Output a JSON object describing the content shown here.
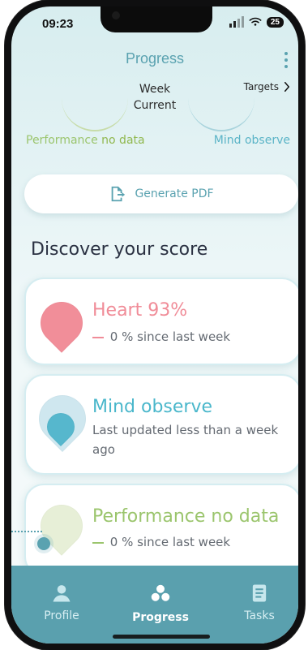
{
  "status": {
    "time": "09:23",
    "battery": "25"
  },
  "header": {
    "title": "Progress",
    "week_label": "Week",
    "current_label": "Current",
    "targets_label": "Targets"
  },
  "legend": {
    "performance_prefix": "Performance",
    "performance_state": "no data",
    "mind_prefix": "Mind",
    "mind_state": "observe"
  },
  "actions": {
    "generate_pdf": "Generate PDF"
  },
  "section": {
    "discover_title": "Discover your score"
  },
  "cards": {
    "heart": {
      "title": "Heart 93%",
      "change": "0 % since last week"
    },
    "mind": {
      "title": "Mind observe",
      "line1": "Last updated less than a week",
      "line2": "ago"
    },
    "performance": {
      "title": "Performance no data",
      "change": "0 % since last week"
    }
  },
  "tabs": [
    {
      "label": "Profile"
    },
    {
      "label": "Progress"
    },
    {
      "label": "Tasks"
    }
  ],
  "colors": {
    "accent": "#5aa2b0",
    "heart": "#f08c98",
    "mind": "#4ab7cb",
    "performance": "#9bc56d"
  }
}
